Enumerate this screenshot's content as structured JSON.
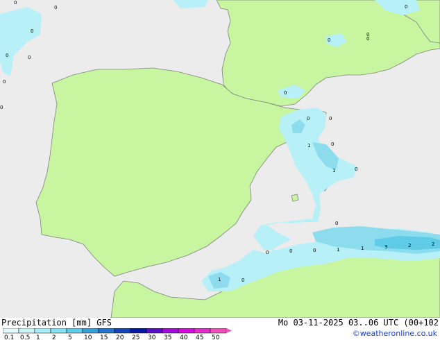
{
  "header": {
    "title": "Precipitation [mm]  GFS",
    "valid_time": "Mo 03-11-2025 03..06 UTC (00+102",
    "credit": "©weatheronline.co.uk"
  },
  "legend": {
    "ticks": [
      "0.1",
      "0.5",
      "1",
      "2",
      "5",
      "10",
      "15",
      "20",
      "25",
      "30",
      "35",
      "40",
      "45",
      "50"
    ],
    "colors": [
      "#e4fbfd",
      "#ccf5fa",
      "#a8eef8",
      "#84e2f2",
      "#5fcbe6",
      "#3a9fd6",
      "#2676cc",
      "#1646b4",
      "#0a1aa0",
      "#5a10c0",
      "#a010d8",
      "#d010d8",
      "#e030c8",
      "#f050b8"
    ]
  },
  "map": {
    "colors": {
      "sea": "#ececec",
      "land": "#c8f6a0",
      "coast": "#7f7f7f",
      "rain_light": "#b8f0f8",
      "rain_mid": "#8cdcee"
    },
    "labels": [
      "0",
      "0",
      "0",
      "0",
      "0",
      "0",
      "0",
      "0",
      "0",
      "0",
      "0",
      "0",
      "0",
      "0",
      "1",
      "0",
      "1",
      "0",
      "0",
      "0",
      "0",
      "0",
      "1",
      "1",
      "3",
      "2",
      "2",
      "1",
      "0"
    ]
  }
}
